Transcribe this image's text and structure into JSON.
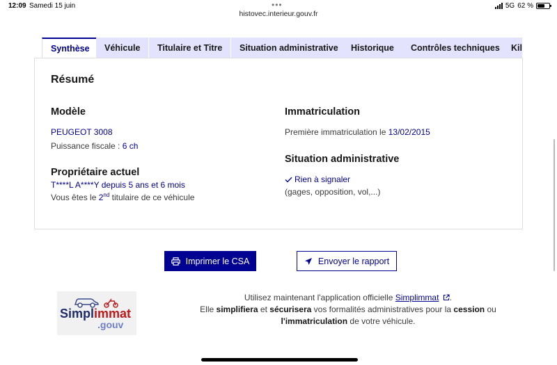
{
  "status": {
    "time": "12:09",
    "date": "Samedi 15 juin",
    "network": "5G",
    "battery": "62 %",
    "battery_level": 0.62
  },
  "browser": {
    "url": "histovec.interieur.gouv.fr"
  },
  "tabs": [
    {
      "label": "Synthèse",
      "active": true
    },
    {
      "label": "Véhicule",
      "active": false
    },
    {
      "label": "Titulaire et Titre",
      "active": false
    },
    {
      "label": "Situation administrative",
      "active": false
    },
    {
      "label": "Historique",
      "active": false
    },
    {
      "label": "Contrôles techniques",
      "active": false
    },
    {
      "label": "Kilométrage",
      "active": false
    }
  ],
  "summary": {
    "title": "Résumé",
    "model": {
      "heading": "Modèle",
      "name": "PEUGEOT 3008",
      "power_label": "Puissance fiscale :",
      "power_value": "6 ch"
    },
    "owner": {
      "heading": "Propriétaire actuel",
      "name": "T****L A****Y",
      "since_label": "depuis",
      "since_value": "5 ans et 6 mois",
      "rank_prefix": "Vous êtes le",
      "rank_num": "2",
      "rank_suffix": "nd",
      "rank_text": "titulaire de ce véhicule"
    },
    "registration": {
      "heading": "Immatriculation",
      "label": "Première immatriculation le",
      "date": "13/02/2015"
    },
    "admin": {
      "heading": "Situation administrative",
      "status": "Rien à signaler",
      "detail": "(gages, opposition, vol,...)"
    }
  },
  "actions": {
    "print": "Imprimer le CSA",
    "send": "Envoyer le rapport"
  },
  "simplimmat": {
    "logo_simpl": "Simpl",
    "logo_immat": "immat",
    "logo_gouv": ".gouv",
    "line1_prefix": "Utilisez maintenant l'application officielle",
    "link": "Simplimmat",
    "line1_suffix": ".",
    "line2_a": "Elle",
    "line2_b": "simplifiera",
    "line2_c": "et",
    "line2_d": "sécurisera",
    "line2_e": "vos formalités administratives pour la",
    "line2_f": "cession",
    "line2_g": "ou",
    "line3_a": "l'immatriculation",
    "line3_b": "de votre véhicule."
  },
  "colors": {
    "primary": "#000091",
    "tab_bg": "#e3e3fd",
    "border": "#dddddd"
  }
}
